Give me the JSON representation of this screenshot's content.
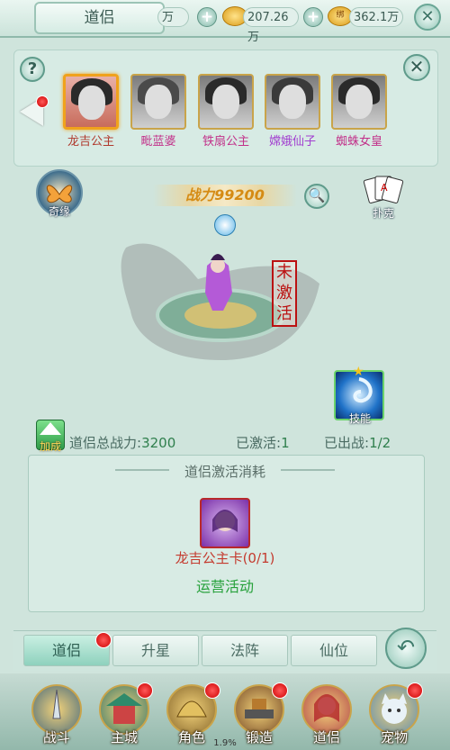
{
  "topbar": {
    "title": "道侣",
    "gold_partial": "万",
    "gold": "207.26万",
    "bound_gold": "362.1万",
    "bound_badge": "绑",
    "close": "✕"
  },
  "panel": {
    "help": "?",
    "close": "✕",
    "characters": [
      {
        "name": "龙吉公主",
        "selected": true,
        "color": "#b03a2e"
      },
      {
        "name": "毗蓝婆",
        "selected": false,
        "color": "#c2318a"
      },
      {
        "name": "铁扇公主",
        "selected": false,
        "color": "#c2318a"
      },
      {
        "name": "嫦娥仙子",
        "selected": false,
        "color": "#a23fd0"
      },
      {
        "name": "蜘蛛女皇",
        "selected": false,
        "color": "#c2318a"
      }
    ]
  },
  "main": {
    "qiyuan": "奇缘",
    "combat_power": "战力99200",
    "puke": "扑克",
    "seal_text": [
      "未",
      "激",
      "活"
    ],
    "skill_label": "技能"
  },
  "stats": {
    "jiazhan": "加成",
    "total_label": "道侣总战力:",
    "total_value": "3200",
    "activated_label": "已激活:",
    "activated_value": "1",
    "deployed_label": "已出战:",
    "deployed_value": "1/2"
  },
  "cost": {
    "title": "道侣激活消耗",
    "card_label": "龙吉公主卡(0/1)",
    "source": "运营活动"
  },
  "tabs": [
    "道侣",
    "升星",
    "法阵",
    "仙位"
  ],
  "bottom_nav": {
    "items": [
      "战斗",
      "主城",
      "角色",
      "锻造",
      "道侣",
      "宠物"
    ],
    "level": "1.9%"
  },
  "colors": {
    "accent": "#2f7f4d",
    "red_dot": "#d40000",
    "gold": "#d58b14"
  }
}
